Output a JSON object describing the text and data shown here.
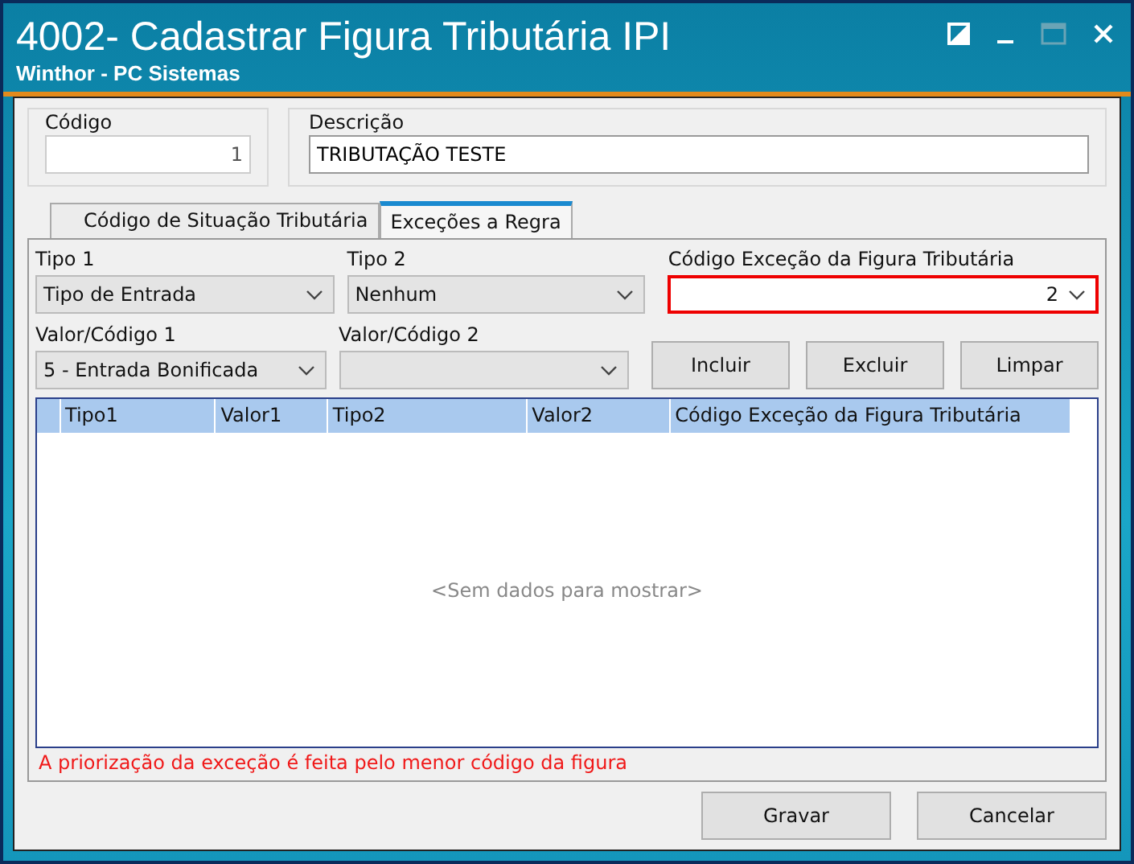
{
  "window": {
    "title": "4002- Cadastrar Figura Tributária IPI",
    "subtitle": "Winthor - PC Sistemas"
  },
  "header": {
    "codigo": {
      "label": "Código",
      "value": "1"
    },
    "descricao": {
      "label": "Descrição",
      "value": "TRIBUTAÇÃO TESTE"
    }
  },
  "tabs": [
    {
      "label": "Código de Situação Tributária",
      "selected": false
    },
    {
      "label": "Exceções a Regra",
      "selected": true
    }
  ],
  "filters": {
    "tipo1": {
      "label": "Tipo 1",
      "value": "Tipo de Entrada"
    },
    "tipo2": {
      "label": "Tipo 2",
      "value": "Nenhum"
    },
    "codigo_excecao": {
      "label": "Código Exceção da Figura Tributária",
      "value": "2",
      "highlighted": true
    },
    "valor1": {
      "label": "Valor/Código 1",
      "value": "5 - Entrada Bonificada"
    },
    "valor2": {
      "label": "Valor/Código 2"
    }
  },
  "actions": [
    "Incluir",
    "Excluir",
    "Limpar"
  ],
  "table": {
    "columns": [
      "Tipo1",
      "Valor1",
      "Tipo2",
      "Valor2",
      "Código Exceção da Figura Tributária"
    ],
    "empty_text": "<Sem dados para mostrar>"
  },
  "note": "A priorização da exceção é feita pelo menor código da figura",
  "buttons": [
    "Gravar",
    "Cancelar"
  ]
}
